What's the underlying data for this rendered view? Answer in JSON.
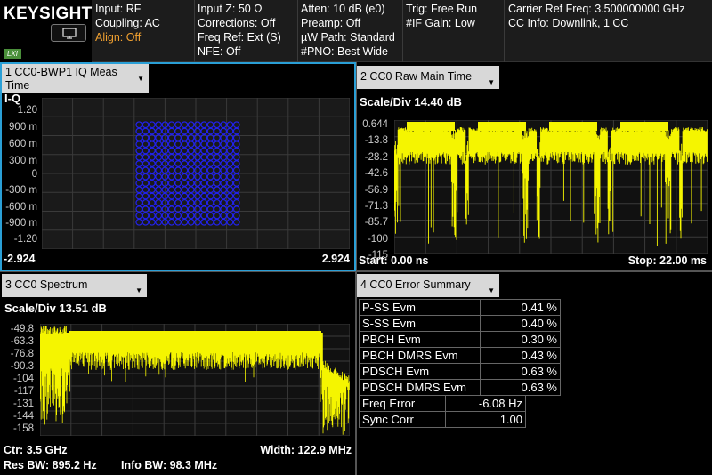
{
  "header": {
    "brand": "KEYSIGHT",
    "lxi_label": "LXI",
    "col1": [
      "Input: RF",
      "Coupling: AC",
      "Align: Off"
    ],
    "col2": [
      "Input Z: 50 Ω",
      "Corrections: Off",
      "Freq Ref: Ext (S)",
      "NFE: Off"
    ],
    "col3": [
      "Atten: 10 dB (e0)",
      "Preamp: Off",
      "µW Path: Standard",
      "#PNO: Best Wide"
    ],
    "col4": [
      "Trig: Free Run",
      "#IF Gain: Low"
    ],
    "col5": [
      "Carrier Ref Freq: 3.500000000 GHz",
      "CC Info: Downlink, 1 CC"
    ]
  },
  "panel1": {
    "title_line1": "1 CC0-BWP1 IQ Meas",
    "title_line2": "Time",
    "plot_label": "I-Q",
    "y_ticks": [
      "1.20",
      "900 m",
      "600 m",
      "300 m",
      "0",
      "-300 m",
      "-600 m",
      "-900 m",
      "-1.20"
    ],
    "x_left": "-2.924",
    "x_right": "2.924",
    "constellation_color": "#2222ee"
  },
  "panel2": {
    "title": "2 CC0 Raw Main Time",
    "scale": "Scale/Div 14.40 dB",
    "y_ticks": [
      "0.644",
      "-13.8",
      "-28.2",
      "-42.6",
      "-56.9",
      "-71.3",
      "-85.7",
      "-100",
      "-115"
    ],
    "start": "Start: 0.00 ns",
    "stop": "Stop: 22.00 ms",
    "trace_color": "#f5f500"
  },
  "panel3": {
    "title": "3 CC0 Spectrum",
    "scale": "Scale/Div 13.51 dB",
    "y_ticks": [
      "-49.8",
      "-63.3",
      "-76.8",
      "-90.3",
      "-104",
      "-117",
      "-131",
      "-144",
      "-158"
    ],
    "ctr": "Ctr: 3.5 GHz",
    "width": "Width: 122.9 MHz",
    "res_bw": "Res BW: 895.2 Hz",
    "info_bw": "Info BW: 98.3 MHz",
    "trace_color": "#f5f500"
  },
  "panel4": {
    "title": "4 CC0 Error Summary",
    "evm_rows": [
      {
        "label": "P-SS Evm",
        "value": "0.41 %"
      },
      {
        "label": "S-SS Evm",
        "value": "0.40 %"
      },
      {
        "label": "PBCH Evm",
        "value": "0.30 %"
      },
      {
        "label": "PBCH DMRS Evm",
        "value": "0.43 %"
      },
      {
        "label": "PDSCH Evm",
        "value": "0.63 %"
      },
      {
        "label": "PDSCH DMRS Evm",
        "value": "0.63 %"
      }
    ],
    "other_rows": [
      {
        "label": "Freq Error",
        "value": "-6.08 Hz"
      },
      {
        "label": "Sync Corr",
        "value": "1.00"
      }
    ]
  }
}
